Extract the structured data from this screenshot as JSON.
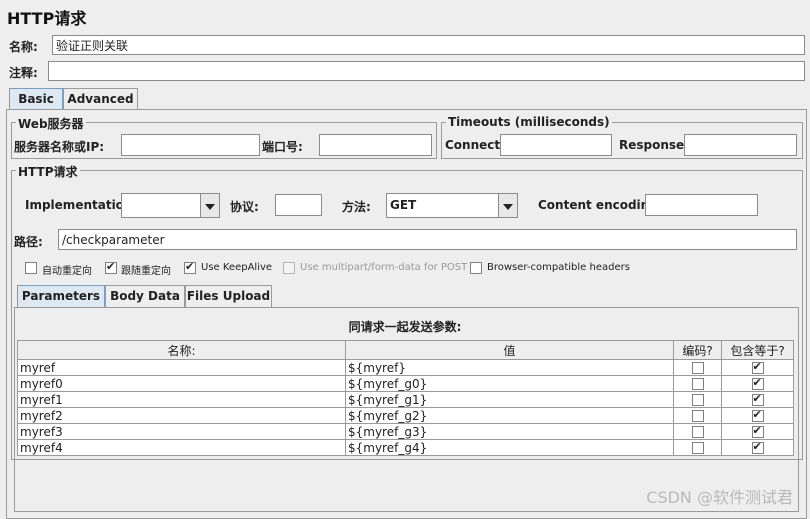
{
  "title": "HTTP请求",
  "name_label": "名称:",
  "name_value": "验证正则关联",
  "comment_label": "注释:",
  "comment_value": "",
  "tabs": [
    {
      "label": "Basic",
      "active": true
    },
    {
      "label": "Advanced",
      "active": false
    }
  ],
  "web_server": {
    "title": "Web服务器",
    "server_label": "服务器名称或IP:",
    "server_value": "",
    "port_label": "端口号:",
    "port_value": ""
  },
  "timeouts": {
    "title": "Timeouts (milliseconds)",
    "connect_label": "Connect:",
    "connect_value": "",
    "response_label": "Response:",
    "response_value": ""
  },
  "http_request": {
    "title": "HTTP请求",
    "implementation_label": "Implementation:",
    "implementation_value": "",
    "protocol_label": "协议:",
    "protocol_value": "",
    "method_label": "方法:",
    "method_value": "GET",
    "encoding_label": "Content encoding:",
    "encoding_value": "",
    "path_label": "路径:",
    "path_value": "/checkparameter"
  },
  "options": [
    {
      "label": "自动重定向",
      "checked": false,
      "disabled": false
    },
    {
      "label": "跟随重定向",
      "checked": true,
      "disabled": false
    },
    {
      "label": "Use KeepAlive",
      "checked": true,
      "disabled": false
    },
    {
      "label": "Use multipart/form-data for POST",
      "checked": false,
      "disabled": true
    },
    {
      "label": "Browser-compatible headers",
      "checked": false,
      "disabled": false
    }
  ],
  "sub_tabs": [
    {
      "label": "Parameters",
      "active": true
    },
    {
      "label": "Body Data",
      "active": false
    },
    {
      "label": "Files Upload",
      "active": false
    }
  ],
  "params": {
    "caption": "同请求一起发送参数:",
    "headers": [
      "名称:",
      "值",
      "编码?",
      "包含等于?"
    ],
    "rows": [
      {
        "name": "myref",
        "value": "${myref}",
        "encode": false,
        "include_equals": true
      },
      {
        "name": "myref0",
        "value": "${myref_g0}",
        "encode": false,
        "include_equals": true
      },
      {
        "name": "myref1",
        "value": "${myref_g1}",
        "encode": false,
        "include_equals": true
      },
      {
        "name": "myref2",
        "value": "${myref_g2}",
        "encode": false,
        "include_equals": true
      },
      {
        "name": "myref3",
        "value": "${myref_g3}",
        "encode": false,
        "include_equals": true
      },
      {
        "name": "myref4",
        "value": "${myref_g4}",
        "encode": false,
        "include_equals": true
      }
    ]
  },
  "watermark": "CSDN @软件测试君"
}
